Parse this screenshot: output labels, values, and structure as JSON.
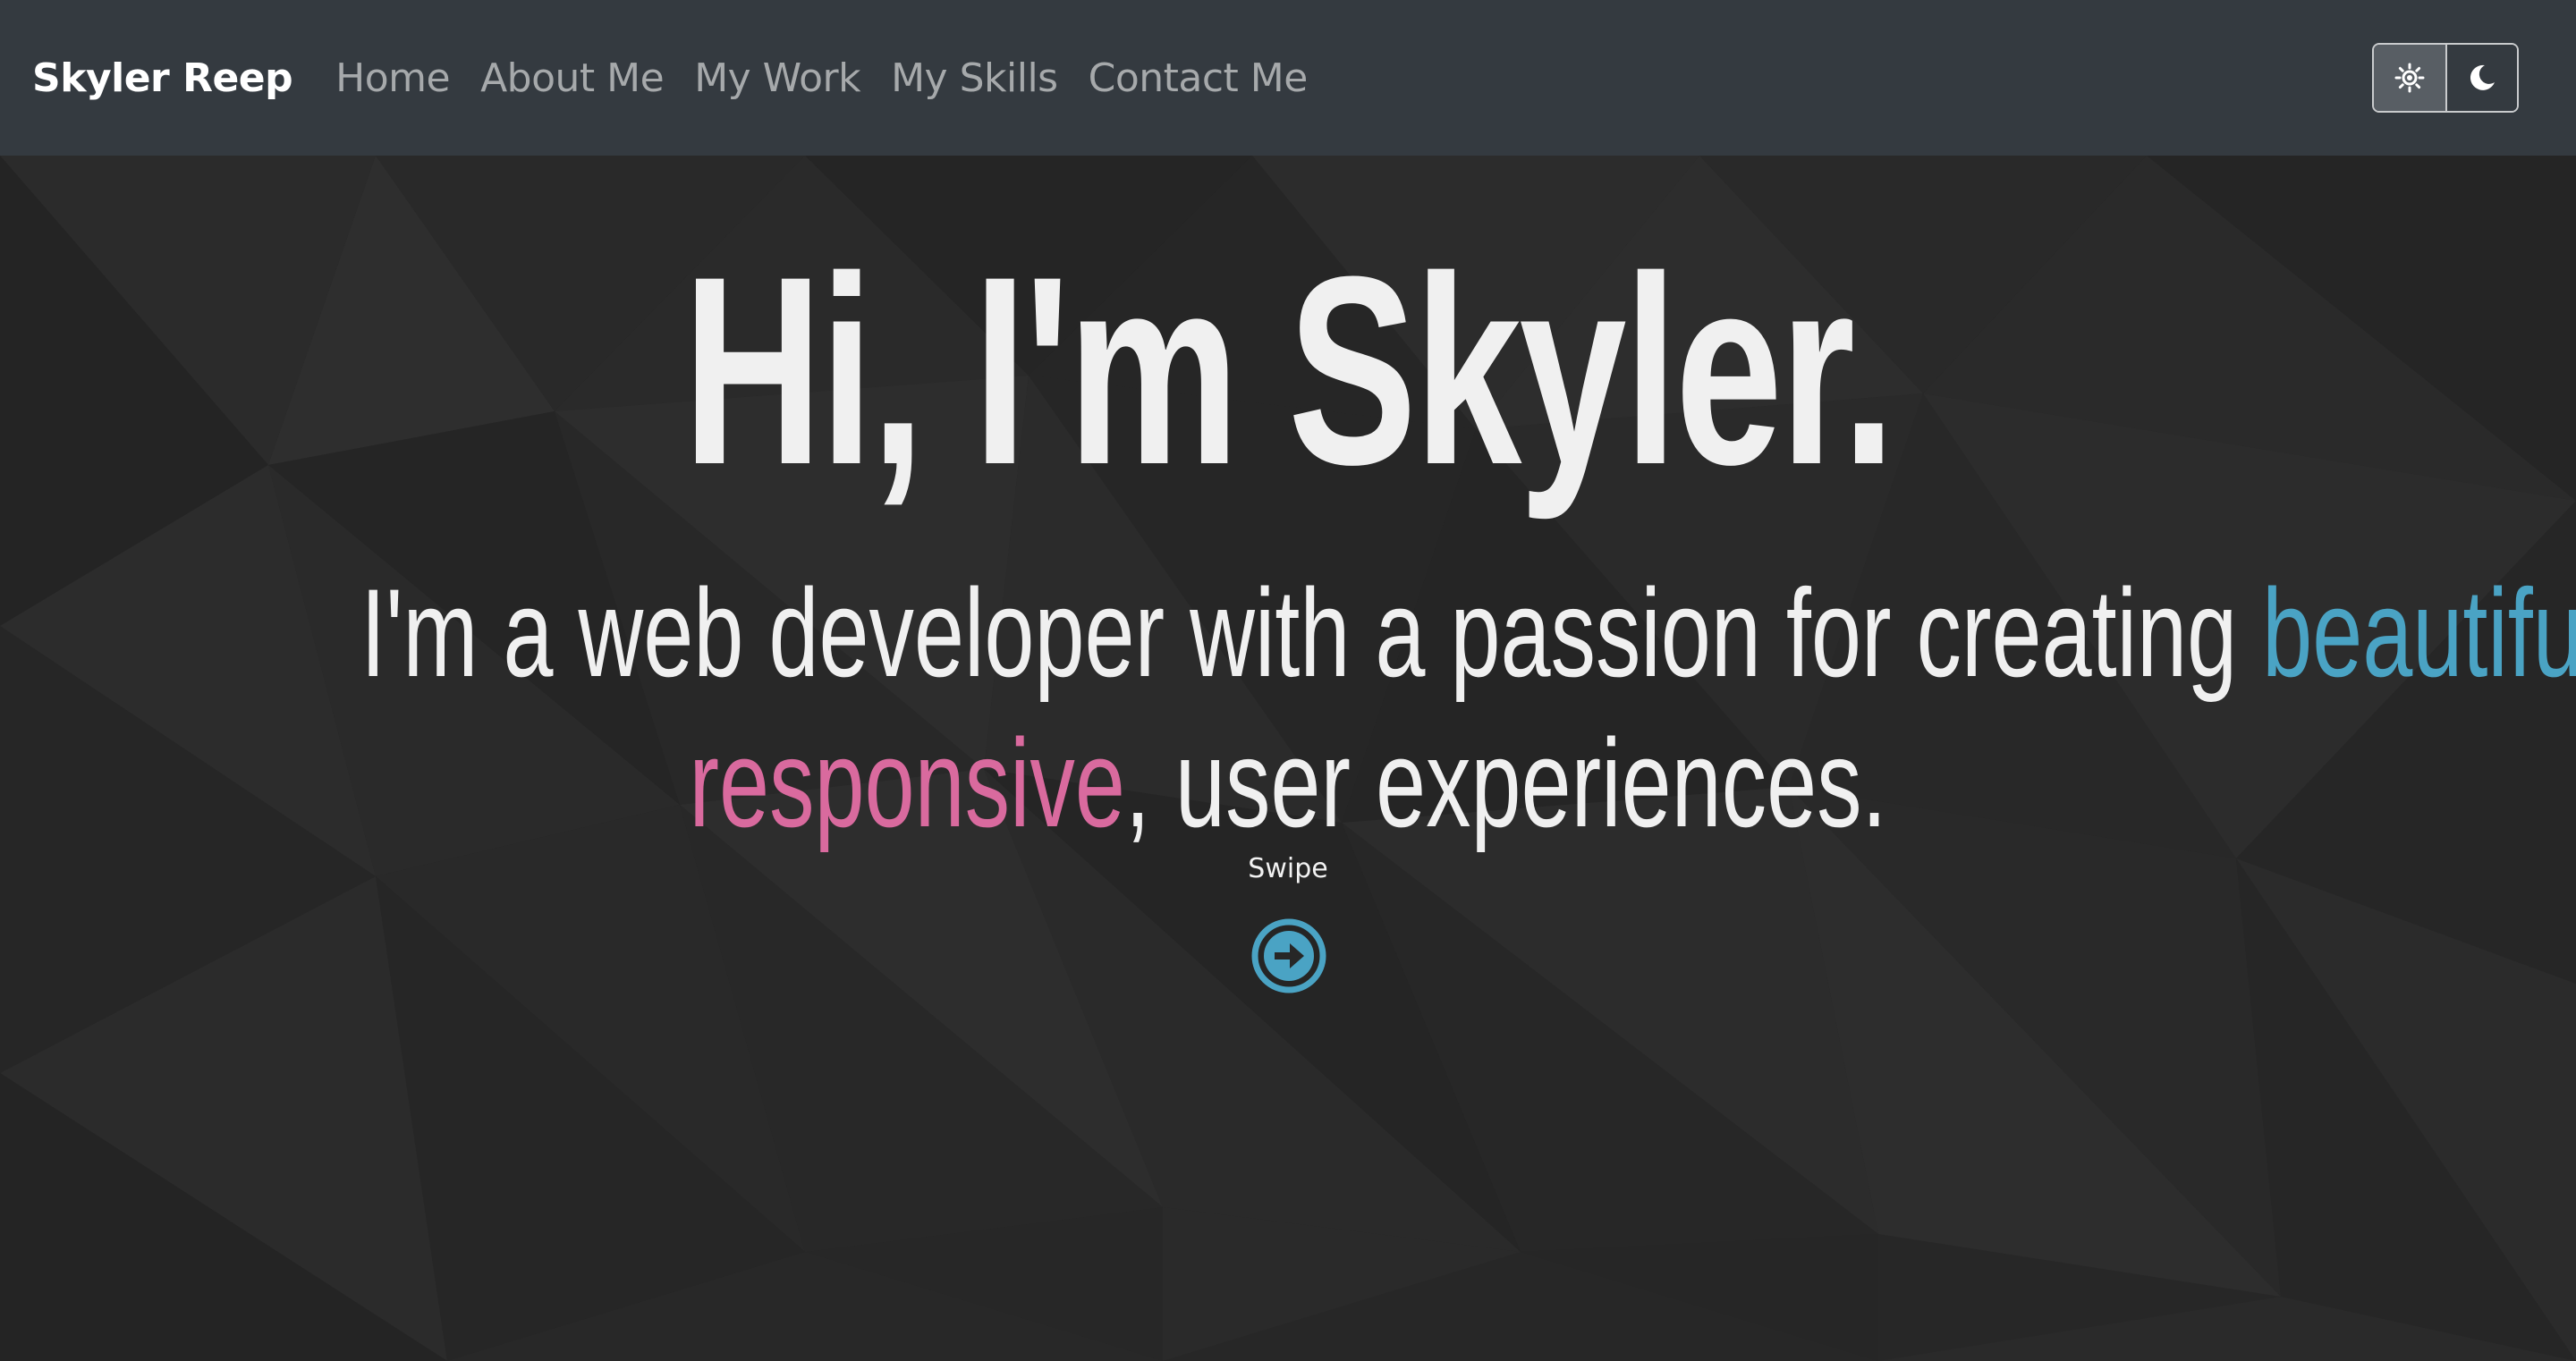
{
  "nav": {
    "brand": "Skyler Reep",
    "links": [
      "Home",
      "About Me",
      "My Work",
      "My Skills",
      "Contact Me"
    ],
    "theme_toggle": {
      "light_icon": "sun-icon",
      "dark_icon": "moon-icon"
    }
  },
  "hero": {
    "title": "Hi, I'm Skyler.",
    "subtitle": {
      "line1_prefix": "I'm a web developer with a passion for creating ",
      "highlight1": "beautiful",
      "line1_suffix": ",",
      "highlight2": "responsive",
      "line2_suffix": ", user experiences."
    },
    "swipe_label": "Swipe",
    "swipe_icon": "arrow-right-circle-icon"
  },
  "colors": {
    "navbar": "#343a40",
    "background": "#272727",
    "accent_blue": "#4aa3c4",
    "accent_pink": "#d96a9e"
  }
}
